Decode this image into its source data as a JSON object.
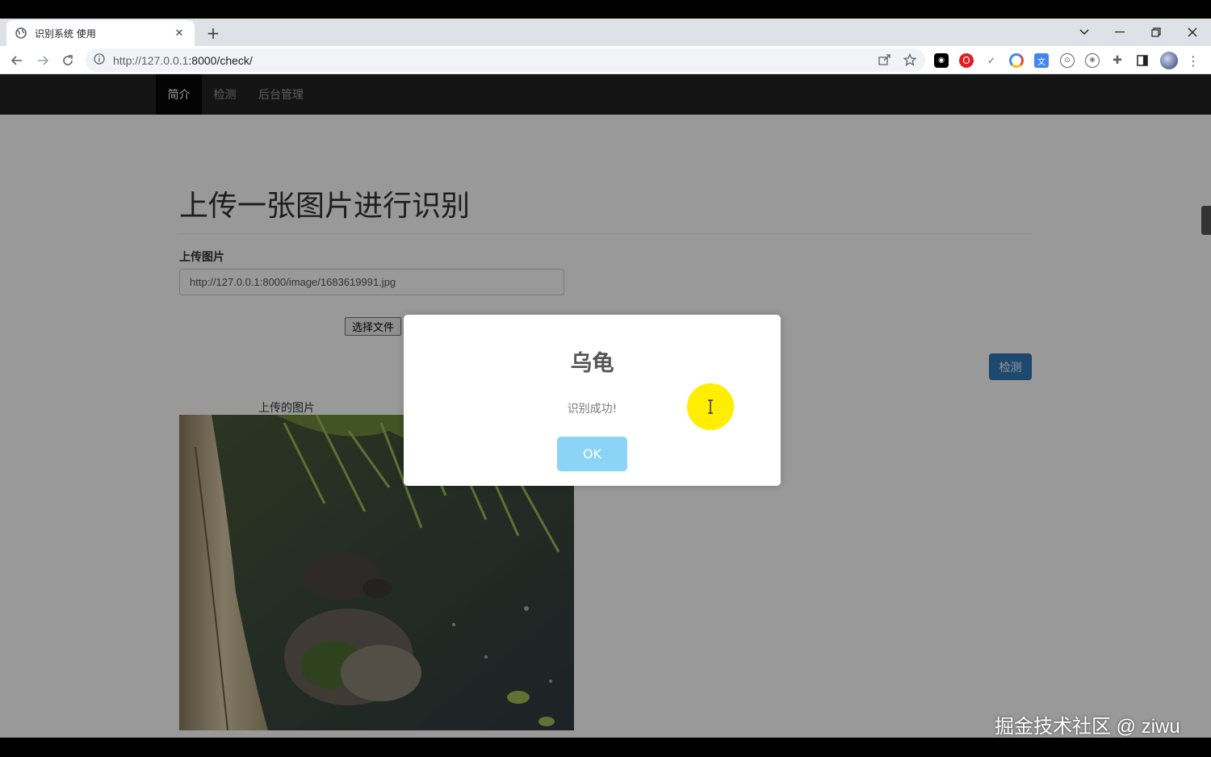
{
  "browser": {
    "tab_title": "识别系统 使用",
    "url_host": "http://127.0.0.1",
    "url_rest": ":8000/check/"
  },
  "nav": {
    "items": [
      {
        "label": "简介",
        "active": true
      },
      {
        "label": "检测",
        "active": false
      },
      {
        "label": "后台管理",
        "active": false
      }
    ]
  },
  "main": {
    "heading": "上传一张图片进行识别",
    "upload_label": "上传图片",
    "image_url": "http://127.0.0.1:8000/image/1683619991.jpg",
    "file_button": "选择文件",
    "detect_button": "检测",
    "image_caption": "上传的图片"
  },
  "modal": {
    "title": "乌龟",
    "text": "识别成功!",
    "ok": "OK"
  },
  "watermark": "掘金技术社区 @ ziwu",
  "colors": {
    "navbar": "#222222",
    "primary_button": "#337ab7",
    "modal_ok": "#8cd4f5",
    "cursor_highlight": "#ffee00"
  }
}
